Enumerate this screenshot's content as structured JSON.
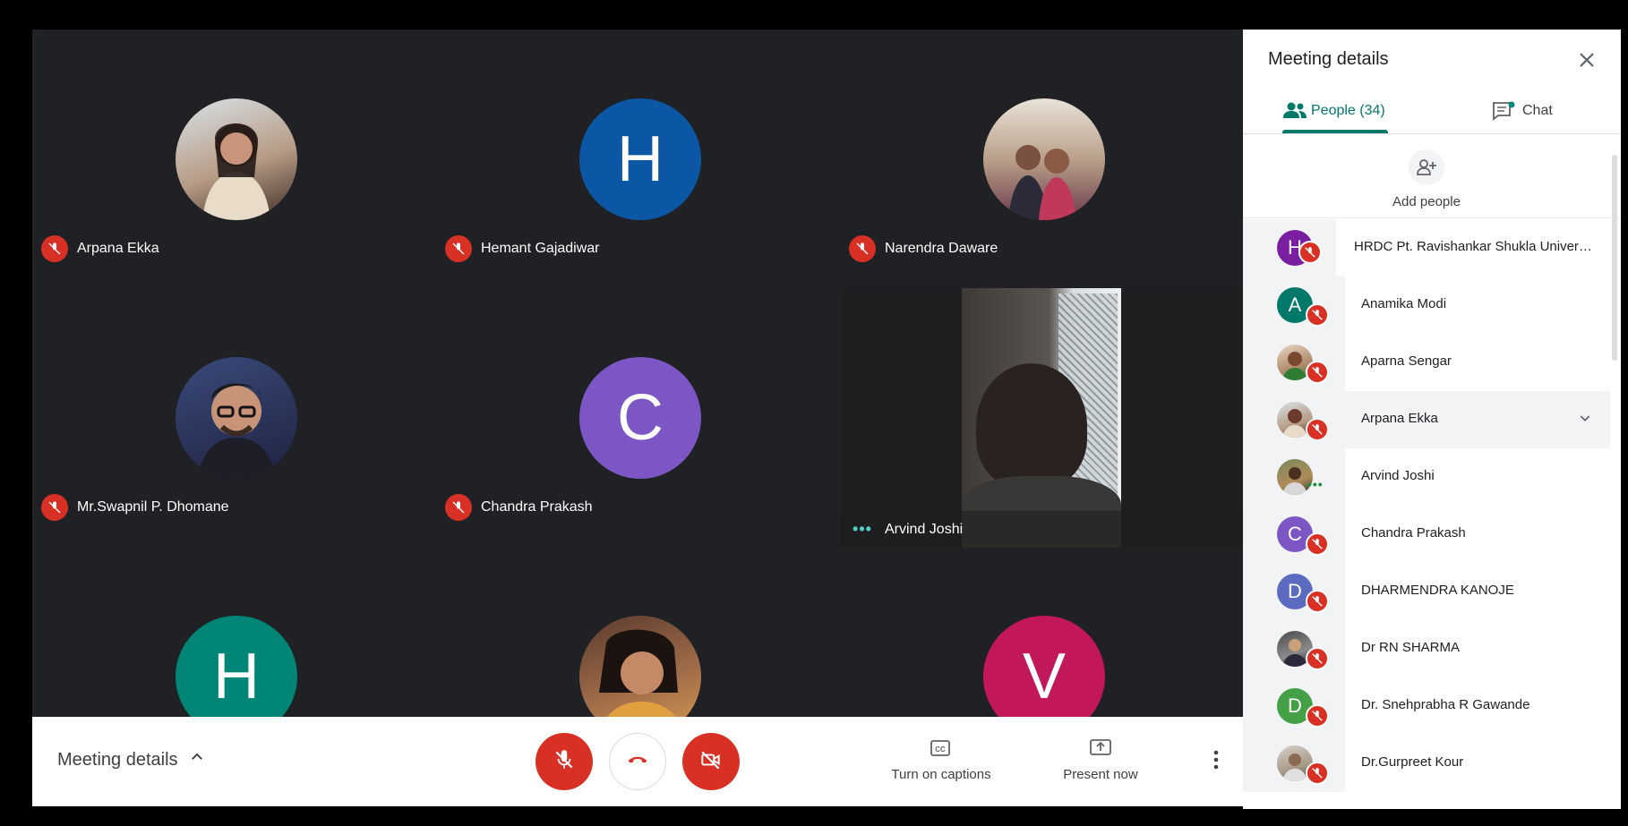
{
  "tiles": [
    {
      "name": "Arpana Ekka",
      "avatar_letter": "",
      "avatar_color": "#c8b6a6",
      "status": "muted"
    },
    {
      "name": "Hemant Gajadiwar",
      "avatar_letter": "H",
      "avatar_color": "#0b57a5",
      "status": "muted"
    },
    {
      "name": "Narendra Daware",
      "avatar_letter": "",
      "avatar_color": "#9a8a7a",
      "status": "muted"
    },
    {
      "name": "Mr.Swapnil P. Dhomane",
      "avatar_letter": "",
      "avatar_color": "#4b5a7a",
      "status": "muted"
    },
    {
      "name": "Chandra Prakash",
      "avatar_letter": "C",
      "avatar_color": "#7b56c4",
      "status": "muted"
    },
    {
      "name": "Arvind Joshi",
      "avatar_letter": "",
      "avatar_color": "#2a2a2a",
      "status": "speaking"
    },
    {
      "name": "",
      "avatar_letter": "H",
      "avatar_color": "#008577",
      "status": ""
    },
    {
      "name": "",
      "avatar_letter": "",
      "avatar_color": "#8a5a3a",
      "status": ""
    },
    {
      "name": "",
      "avatar_letter": "V",
      "avatar_color": "#c2185b",
      "status": ""
    }
  ],
  "bottombar": {
    "meeting_details_label": "Meeting details",
    "captions_label": "Turn on captions",
    "present_label": "Present now"
  },
  "panel": {
    "title": "Meeting details",
    "people_tab": "People (34)",
    "chat_tab": "Chat",
    "add_people_label": "Add people",
    "participants": [
      {
        "name": "HRDC Pt. Ravishankar Shukla Universi...",
        "letter": "H",
        "color": "#7b1fa2",
        "status": "muted"
      },
      {
        "name": "Anamika Modi",
        "letter": "A",
        "color": "#00796b",
        "status": "muted"
      },
      {
        "name": "Aparna Sengar",
        "letter": "",
        "color": "#b58a6a",
        "status": "muted"
      },
      {
        "name": "Arpana Ekka",
        "letter": "",
        "color": "#c8b6a6",
        "status": "muted"
      },
      {
        "name": "Arvind Joshi",
        "letter": "",
        "color": "#8d7a5a",
        "status": "speaking"
      },
      {
        "name": "Chandra Prakash",
        "letter": "C",
        "color": "#7b56c4",
        "status": "muted"
      },
      {
        "name": "DHARMENDRA KANOJE",
        "letter": "D",
        "color": "#5c6bc0",
        "status": "muted"
      },
      {
        "name": "Dr RN SHARMA",
        "letter": "",
        "color": "#6a6a6a",
        "status": "muted"
      },
      {
        "name": "Dr. Snehprabha R Gawande",
        "letter": "D",
        "color": "#43a047",
        "status": "muted"
      },
      {
        "name": "Dr.Gurpreet Kour",
        "letter": "",
        "color": "#a89a8a",
        "status": "muted"
      }
    ]
  }
}
